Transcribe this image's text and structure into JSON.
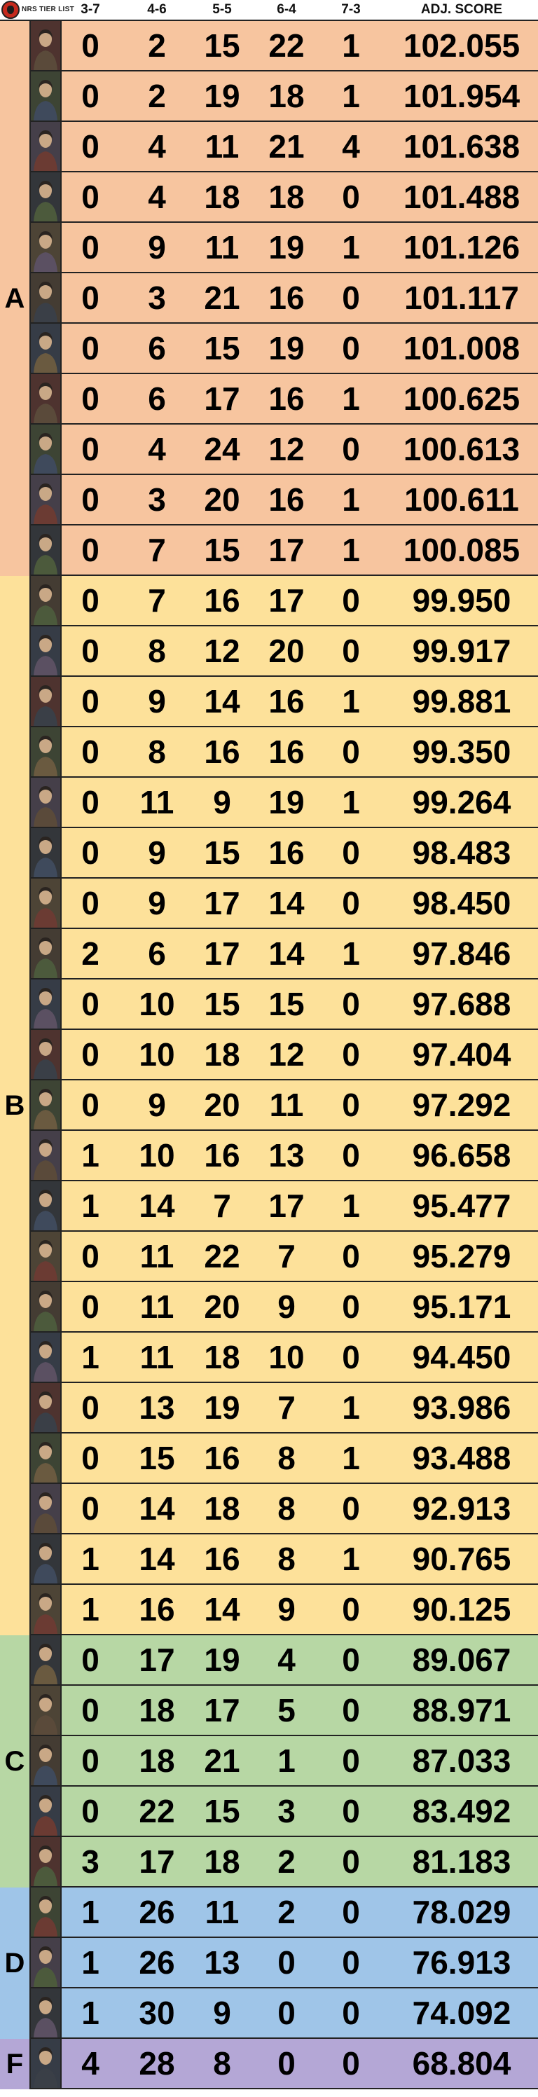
{
  "header": {
    "logo_text": "NRS TIER LIST",
    "columns": [
      "3-7",
      "4-6",
      "5-5",
      "6-4",
      "7-3",
      "ADJ. SCORE"
    ]
  },
  "tiers": [
    {
      "label": "A",
      "color": "#f7c59f",
      "rows": [
        [
          "0",
          "2",
          "15",
          "22",
          "1",
          "102.055"
        ],
        [
          "0",
          "2",
          "19",
          "18",
          "1",
          "101.954"
        ],
        [
          "0",
          "4",
          "11",
          "21",
          "4",
          "101.638"
        ],
        [
          "0",
          "4",
          "18",
          "18",
          "0",
          "101.488"
        ],
        [
          "0",
          "9",
          "11",
          "19",
          "1",
          "101.126"
        ],
        [
          "0",
          "3",
          "21",
          "16",
          "0",
          "101.117"
        ],
        [
          "0",
          "6",
          "15",
          "19",
          "0",
          "101.008"
        ],
        [
          "0",
          "6",
          "17",
          "16",
          "1",
          "100.625"
        ],
        [
          "0",
          "4",
          "24",
          "12",
          "0",
          "100.613"
        ],
        [
          "0",
          "3",
          "20",
          "16",
          "1",
          "100.611"
        ],
        [
          "0",
          "7",
          "15",
          "17",
          "1",
          "100.085"
        ]
      ]
    },
    {
      "label": "B",
      "color": "#fde19a",
      "rows": [
        [
          "0",
          "7",
          "16",
          "17",
          "0",
          "99.950"
        ],
        [
          "0",
          "8",
          "12",
          "20",
          "0",
          "99.917"
        ],
        [
          "0",
          "9",
          "14",
          "16",
          "1",
          "99.881"
        ],
        [
          "0",
          "8",
          "16",
          "16",
          "0",
          "99.350"
        ],
        [
          "0",
          "11",
          "9",
          "19",
          "1",
          "99.264"
        ],
        [
          "0",
          "9",
          "15",
          "16",
          "0",
          "98.483"
        ],
        [
          "0",
          "9",
          "17",
          "14",
          "0",
          "98.450"
        ],
        [
          "2",
          "6",
          "17",
          "14",
          "1",
          "97.846"
        ],
        [
          "0",
          "10",
          "15",
          "15",
          "0",
          "97.688"
        ],
        [
          "0",
          "10",
          "18",
          "12",
          "0",
          "97.404"
        ],
        [
          "0",
          "9",
          "20",
          "11",
          "0",
          "97.292"
        ],
        [
          "1",
          "10",
          "16",
          "13",
          "0",
          "96.658"
        ],
        [
          "1",
          "14",
          "7",
          "17",
          "1",
          "95.477"
        ],
        [
          "0",
          "11",
          "22",
          "7",
          "0",
          "95.279"
        ],
        [
          "0",
          "11",
          "20",
          "9",
          "0",
          "95.171"
        ],
        [
          "1",
          "11",
          "18",
          "10",
          "0",
          "94.450"
        ],
        [
          "0",
          "13",
          "19",
          "7",
          "1",
          "93.986"
        ],
        [
          "0",
          "15",
          "16",
          "8",
          "1",
          "93.488"
        ],
        [
          "0",
          "14",
          "18",
          "8",
          "0",
          "92.913"
        ],
        [
          "1",
          "14",
          "16",
          "8",
          "1",
          "90.765"
        ],
        [
          "1",
          "16",
          "14",
          "9",
          "0",
          "90.125"
        ]
      ]
    },
    {
      "label": "C",
      "color": "#b7d7a4",
      "rows": [
        [
          "0",
          "17",
          "19",
          "4",
          "0",
          "89.067"
        ],
        [
          "0",
          "18",
          "17",
          "5",
          "0",
          "88.971"
        ],
        [
          "0",
          "18",
          "21",
          "1",
          "0",
          "87.033"
        ],
        [
          "0",
          "22",
          "15",
          "3",
          "0",
          "83.492"
        ],
        [
          "3",
          "17",
          "18",
          "2",
          "0",
          "81.183"
        ]
      ]
    },
    {
      "label": "D",
      "color": "#9fc5e8",
      "rows": [
        [
          "1",
          "26",
          "11",
          "2",
          "0",
          "78.029"
        ],
        [
          "1",
          "26",
          "13",
          "0",
          "0",
          "76.913"
        ],
        [
          "1",
          "30",
          "9",
          "0",
          "0",
          "74.092"
        ]
      ]
    },
    {
      "label": "F",
      "color": "#b4a7d6",
      "rows": [
        [
          "4",
          "28",
          "8",
          "0",
          "0",
          "68.804"
        ]
      ]
    }
  ]
}
